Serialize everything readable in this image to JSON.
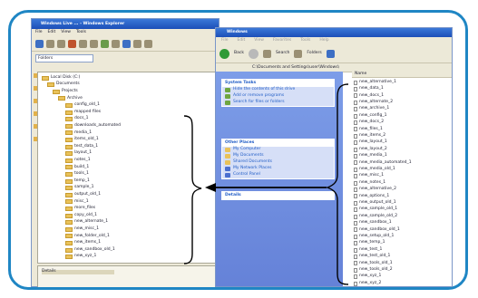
{
  "left_window": {
    "title": "Windows Live ... - Windows Explorer",
    "menu": [
      "File",
      "Edit",
      "View",
      "Tools"
    ],
    "address": "Folders",
    "tree_items": [
      "Local Disk (C:)",
      "Documents",
      "Projects",
      "Archive",
      "config_old_1",
      "mapped files",
      "docs_1",
      "downloads_automated",
      "media_1",
      "items_old_1",
      "test_data_1",
      "layout_1",
      "notes_1",
      "build_1",
      "tools_1",
      "temp_1",
      "sample_1",
      "output_old_1",
      "misc_1",
      "more_files",
      "copy_old_1",
      "new_alternate_1",
      "new_misc_1",
      "new_folder_old_1",
      "new_items_1",
      "new_sandbox_old_1",
      "new_xyz_1"
    ],
    "bottom_label": "Details"
  },
  "right_window": {
    "title": "Windows",
    "menu": [
      "File",
      "Edit",
      "View",
      "Favorites",
      "Tools",
      "Help"
    ],
    "toolbar": {
      "back": "Back",
      "search": "Search",
      "folders": "Folders"
    },
    "address": "C:\\Documents and Settings\\user\\Windows\\",
    "task_groups": [
      {
        "title": "System Tasks",
        "items": [
          "Hide the contents of this drive",
          "Add or remove programs",
          "Search for files or folders"
        ]
      },
      {
        "title": "Other Places",
        "items": [
          "My Computer",
          "My Documents",
          "Shared Documents",
          "My Network Places",
          "Control Panel"
        ]
      },
      {
        "title": "Details",
        "items": []
      }
    ],
    "list_header": "Name",
    "files": [
      "new_alternative_1",
      "new_data_1",
      "new_docs_1",
      "new_alternate_2",
      "new_archive_1",
      "new_config_1",
      "new_docs_2",
      "new_files_1",
      "new_items_2",
      "new_layout_1",
      "new_layout_2",
      "new_media_1",
      "new_media_automated_1",
      "new_media_old_1",
      "new_misc_1",
      "new_notes_1",
      "new_alternative_2",
      "new_options_1",
      "new_output_old_1",
      "new_sample_old_1",
      "new_sample_old_2",
      "new_sandbox_1",
      "new_sandbox_old_1",
      "new_setup_old_1",
      "new_temp_1",
      "new_test_1",
      "new_test_old_1",
      "new_tools_old_1",
      "new_tools_old_2",
      "new_xyz_1",
      "new_xyz_2"
    ]
  },
  "colors": {
    "frame": "#1f86c4",
    "task_pane": "#6f8ddf",
    "titlebar": "#2a63cc"
  }
}
